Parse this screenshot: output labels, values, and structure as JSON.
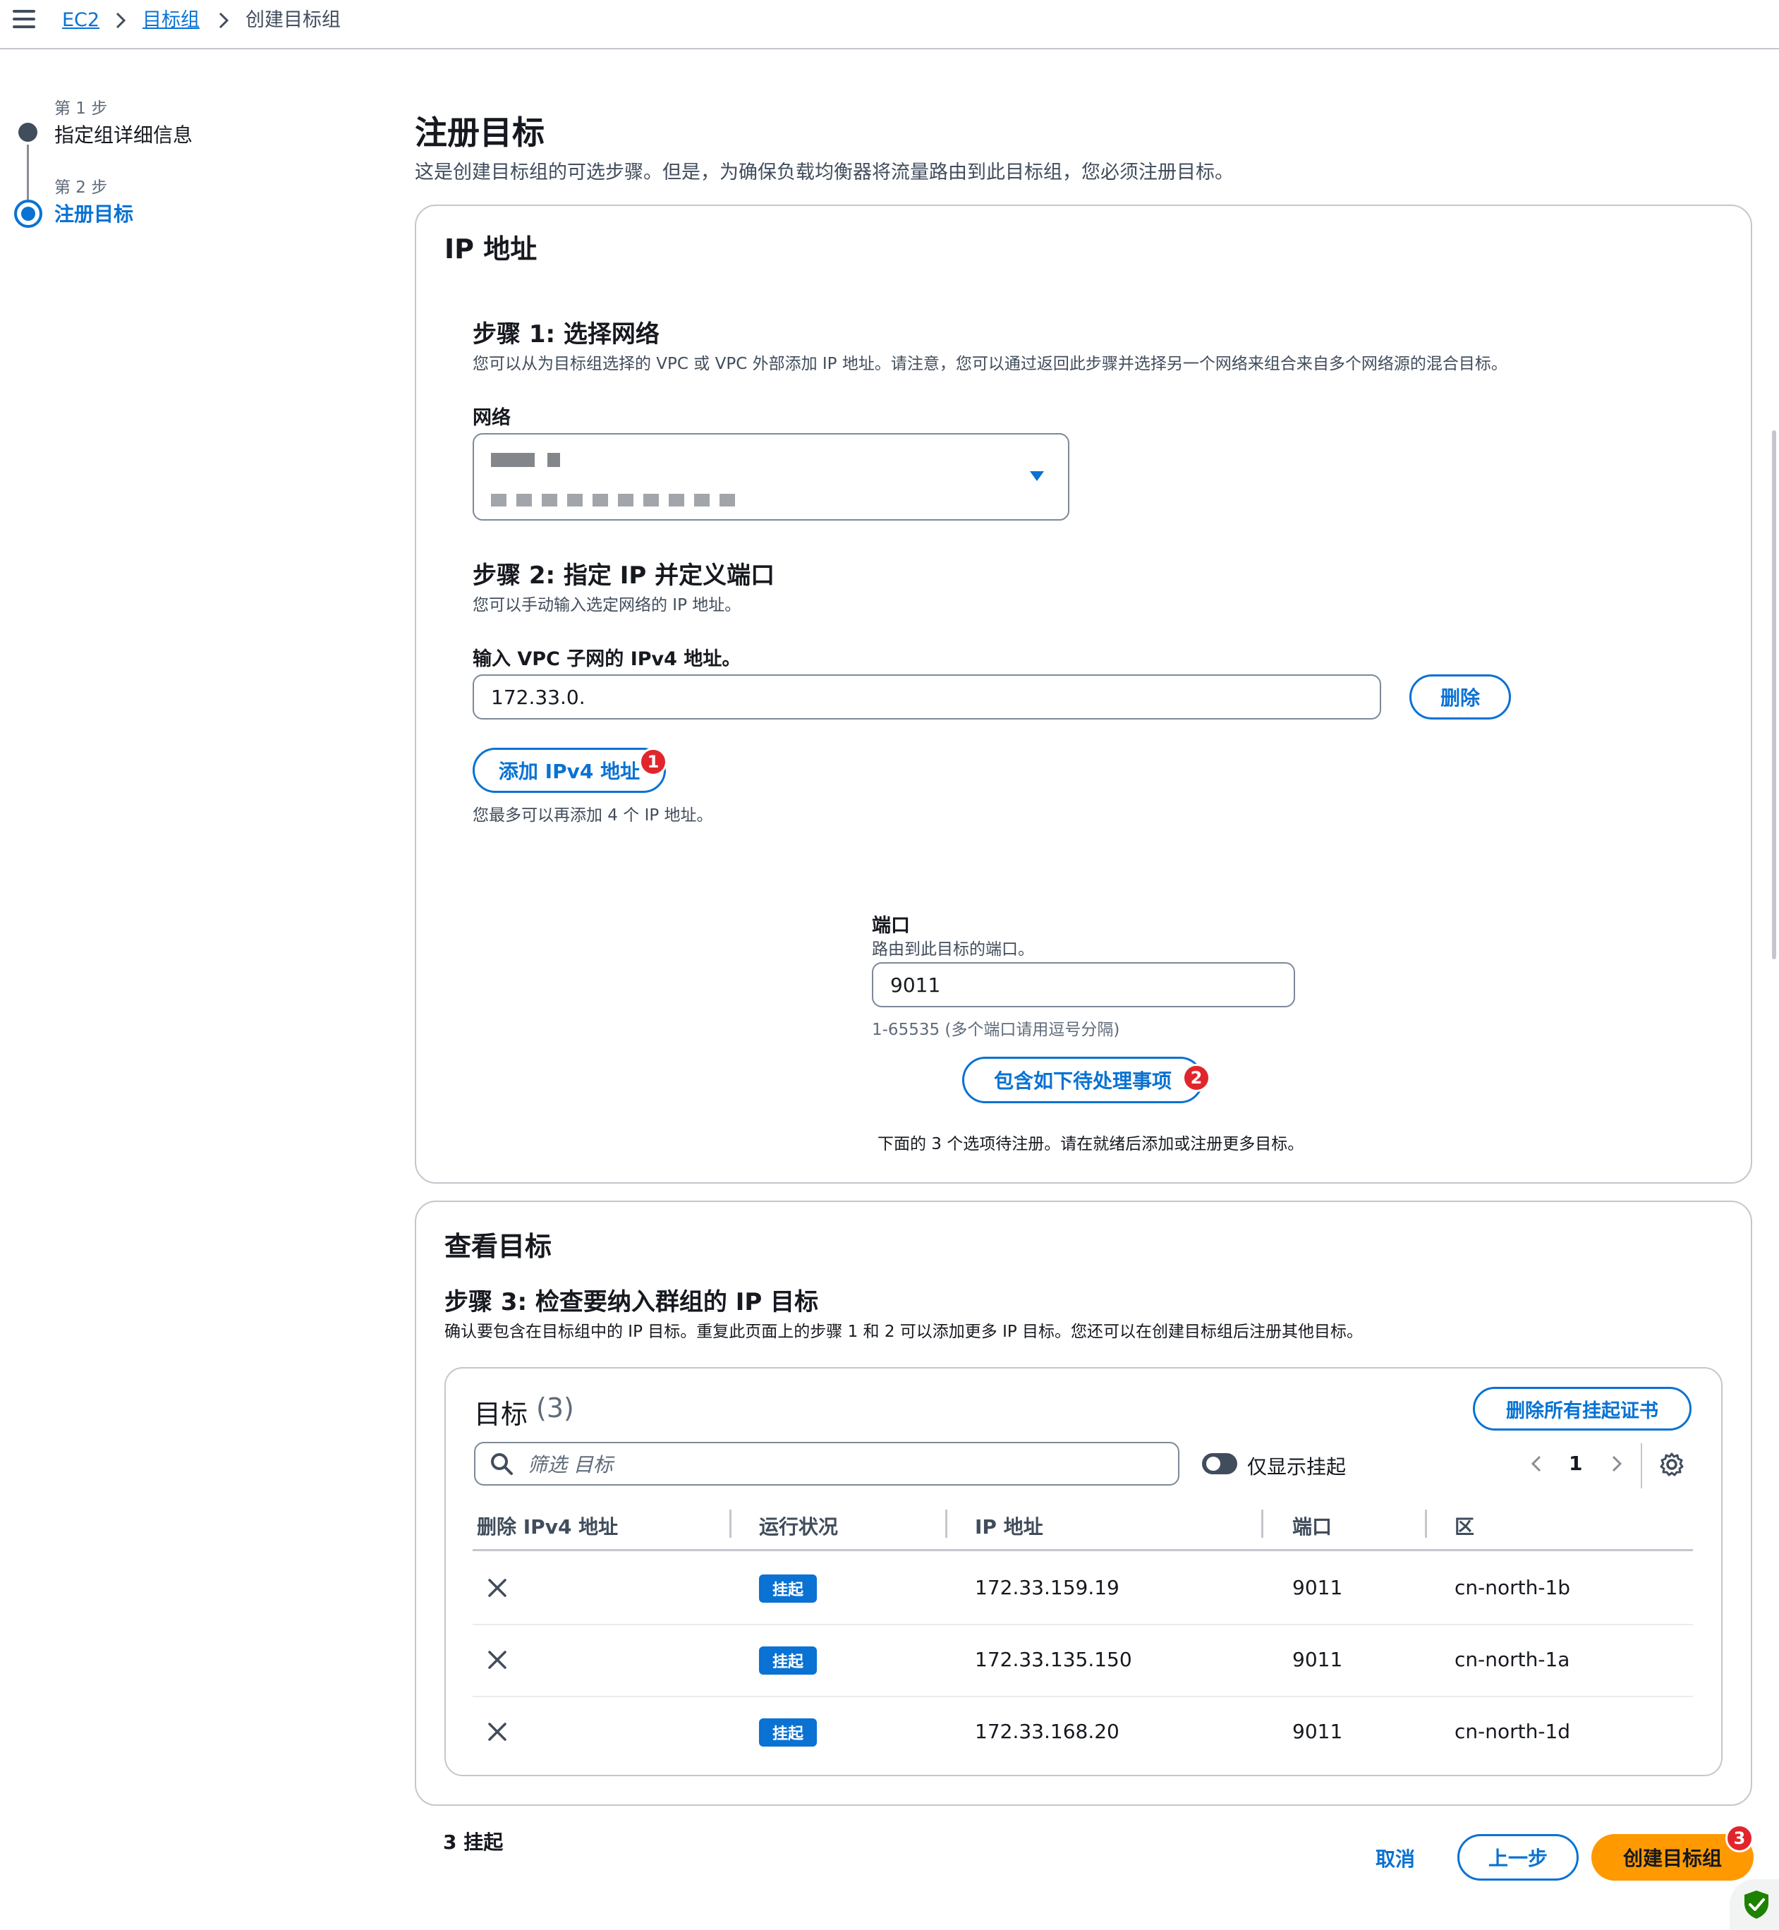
{
  "breadcrumb": {
    "items": [
      "EC2",
      "目标组",
      "创建目标组"
    ]
  },
  "steps": [
    {
      "number_label": "第 1 步",
      "label": "指定组详细信息"
    },
    {
      "number_label": "第 2 步",
      "label": "注册目标"
    }
  ],
  "page": {
    "title": "注册目标",
    "description": "这是创建目标组的可选步骤。但是，为确保负载均衡器将流量路由到此目标组，您必须注册目标。"
  },
  "ip_panel": {
    "title": "IP 地址",
    "step1": {
      "title": "步骤 1: 选择网络",
      "description": "您可以从为目标组选择的 VPC 或 VPC 外部添加 IP 地址。请注意，您可以通过返回此步骤并选择另一个网络来组合来自多个网络源的混合目标。",
      "network_label": "网络"
    },
    "step2": {
      "title": "步骤 2: 指定 IP 并定义端口",
      "description": "您可以手动输入选定网络的 IP 地址。",
      "ipv4_label": "输入 VPC 子网的 IPv4 地址。",
      "ipv4_value": "172.33.0.",
      "remove_label": "删除",
      "add_label": "添加 IPv4 地址",
      "add_badge": "1",
      "add_hint": "您最多可以再添加 4 个 IP 地址。"
    },
    "port": {
      "label": "端口",
      "description": "路由到此目标的端口。",
      "value": "9011",
      "hint": "1-65535 (多个端口请用逗号分隔)",
      "include_label": "包含如下待处理事项",
      "include_badge": "2",
      "pending_note": "下面的 3 个选项待注册。请在就绪后添加或注册更多目标。"
    }
  },
  "review_panel": {
    "title": "查看目标",
    "step3_title": "步骤 3: 检查要纳入群组的 IP 目标",
    "step3_desc": "确认要包含在目标组中的 IP 目标。重复此页面上的步骤 1 和 2 可以添加更多 IP 目标。您还可以在创建目标组后注册其他目标。",
    "table": {
      "title": "目标",
      "count": "(3)",
      "remove_all_label": "删除所有挂起证书",
      "filter_placeholder": "筛选 目标",
      "toggle_label": "仅显示挂起",
      "page_number": "1",
      "columns": [
        "删除 IPv4 地址",
        "运行状况",
        "IP 地址",
        "端口",
        "区"
      ],
      "rows": [
        {
          "health": "挂起",
          "ip": "172.33.159.19",
          "port": "9011",
          "zone": "cn-north-1b"
        },
        {
          "health": "挂起",
          "ip": "172.33.135.150",
          "port": "9011",
          "zone": "cn-north-1a"
        },
        {
          "health": "挂起",
          "ip": "172.33.168.20",
          "port": "9011",
          "zone": "cn-north-1d"
        }
      ]
    }
  },
  "footer": {
    "pending_count": "3 挂起",
    "cancel_label": "取消",
    "prev_label": "上一步",
    "create_label": "创建目标组",
    "create_badge": "3"
  },
  "colors": {
    "accent": "#0972d3",
    "primary_button": "#ff9900",
    "badge": "#e0262c"
  }
}
